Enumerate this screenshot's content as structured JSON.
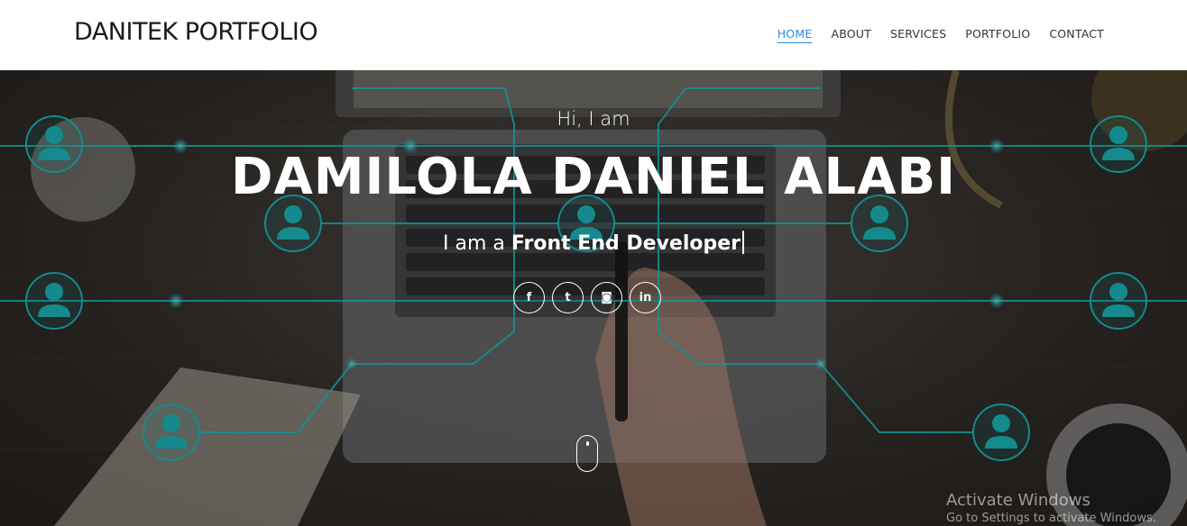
{
  "nav": {
    "brand": "DANITEK PORTFOLIO",
    "links": [
      "HOME",
      "ABOUT",
      "SERVICES",
      "PORTFOLIO",
      "CONTACT"
    ],
    "active_link": "HOME",
    "active_color": "#2a8be0"
  },
  "hero": {
    "greeting": "Hi, I am",
    "name": "DAMILOLA DANIEL ALABI",
    "tagline_prefix": "I am a",
    "tagline_role": "Front End Developer",
    "accent_color": "#19a9ad",
    "social_icons": [
      {
        "name": "facebook-icon",
        "glyph": "f"
      },
      {
        "name": "twitter-icon",
        "glyph": "t"
      },
      {
        "name": "instagram-icon",
        "glyph": "◙"
      },
      {
        "name": "linkedin-icon",
        "glyph": "in"
      }
    ],
    "scroll_indicator": "mouse-scroll-icon"
  },
  "watermark": {
    "line1": "Activate Windows",
    "line2": "Go to Settings to activate Windows."
  }
}
